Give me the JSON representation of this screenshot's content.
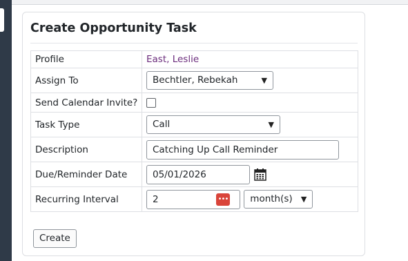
{
  "form": {
    "title": "Create Opportunity Task",
    "profile": {
      "label": "Profile",
      "value": "East, Leslie"
    },
    "assign_to": {
      "label": "Assign To",
      "value": "Bechtler, Rebekah"
    },
    "send_calendar_invite": {
      "label": "Send Calendar Invite?",
      "checked": false
    },
    "task_type": {
      "label": "Task Type",
      "value": "Call"
    },
    "description": {
      "label": "Description",
      "value": "Catching Up Call Reminder"
    },
    "due_date": {
      "label": "Due/Reminder Date",
      "value": "05/01/2026"
    },
    "recurring_interval": {
      "label": "Recurring Interval",
      "value": "2",
      "badge": "•••",
      "unit": "month(s)"
    },
    "create_label": "Create"
  },
  "icons": {
    "calendar": "calendar-icon",
    "chevron": "chevron-down-icon",
    "password_manager": "ellipsis-badge-icon"
  },
  "colors": {
    "link": "#6b2c7c",
    "badge": "#d9443a",
    "sidebar": "#2f3a48"
  }
}
